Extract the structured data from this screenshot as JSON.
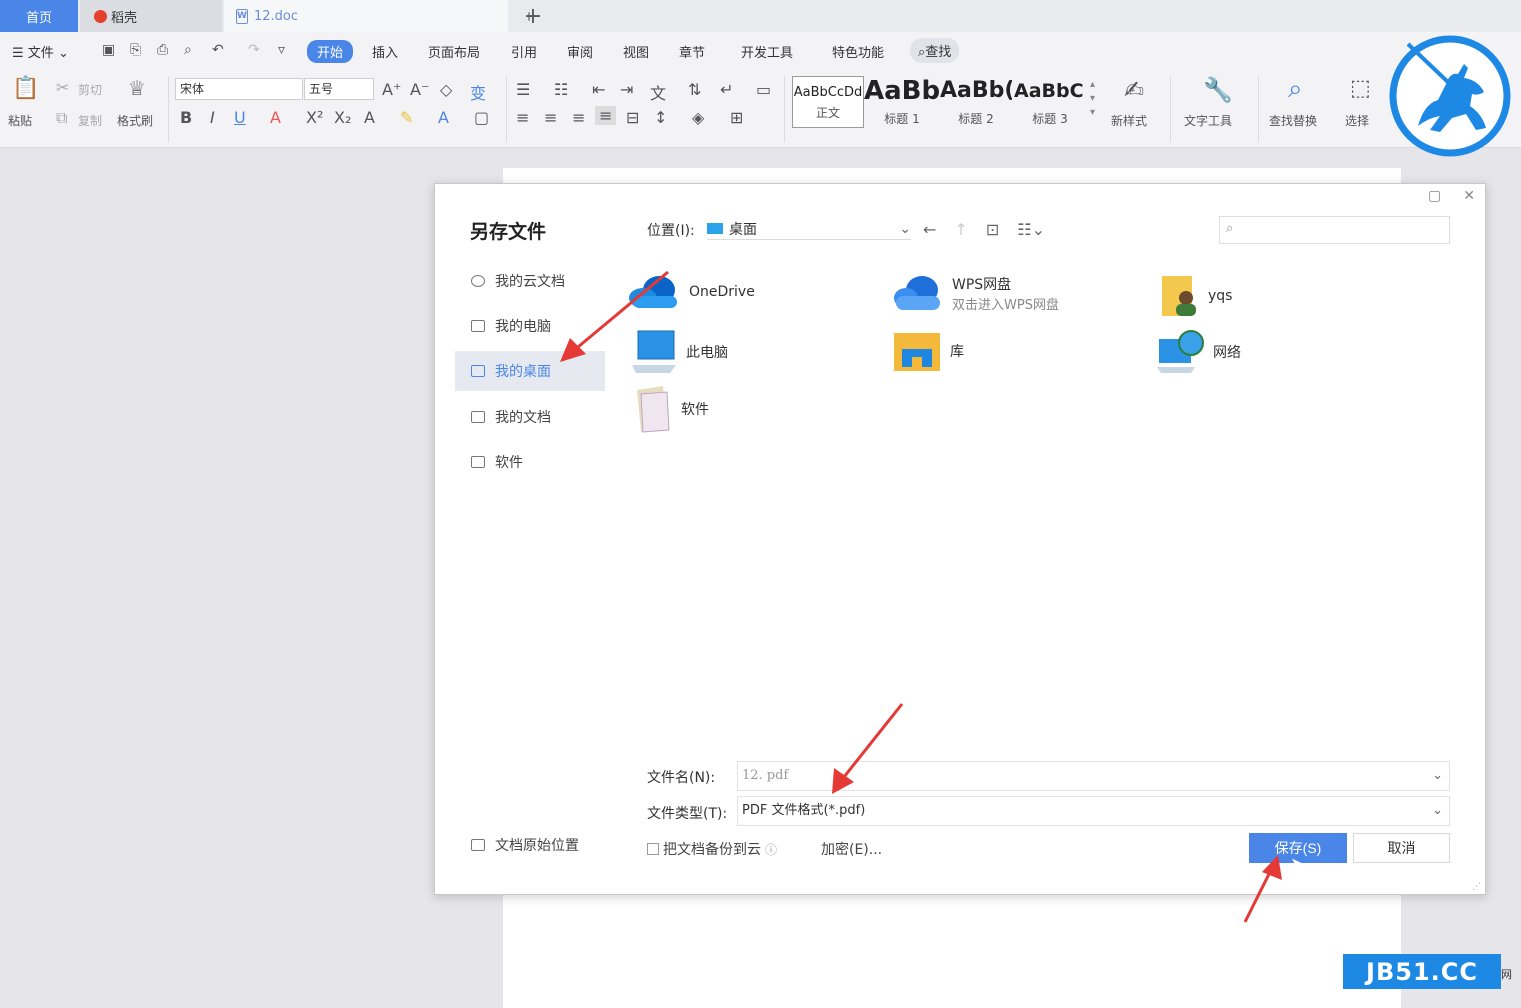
{
  "tabs": {
    "home": "首页",
    "daoke": "稻壳",
    "doc": "12.doc",
    "doc_icon_letter": "W",
    "plus": "+"
  },
  "menu": {
    "file": "文件",
    "items": [
      "开始",
      "插入",
      "页面布局",
      "引用",
      "审阅",
      "视图",
      "章节",
      "开发工具",
      "特色功能"
    ],
    "search": "查找"
  },
  "ribbon": {
    "paste": "粘贴",
    "cut": "剪切",
    "copy": "复制",
    "format_painter": "格式刷",
    "font_name": "宋体",
    "font_size": "五号",
    "styles": [
      {
        "sample": "AaBbCcDd",
        "name": "正文"
      },
      {
        "sample": "AaBb",
        "name": "标题 1"
      },
      {
        "sample": "AaBb(",
        "name": "标题 2"
      },
      {
        "sample": "AaBbC",
        "name": "标题 3"
      }
    ],
    "new_style": "新样式",
    "text_tools": "文字工具",
    "find_replace": "查找替换",
    "select": "选择"
  },
  "dialog": {
    "title": "另存文件",
    "sidebar": [
      "我的云文档",
      "我的电脑",
      "我的桌面",
      "我的文档",
      "软件"
    ],
    "active_sidebar": "我的桌面",
    "location_label": "位置(I):",
    "location_value": "桌面",
    "files": [
      {
        "name": "OneDrive",
        "sub": "",
        "icon": "onedrive-cloud-icon"
      },
      {
        "name": "WPS网盘",
        "sub": "双击进入WPS网盘",
        "icon": "wps-cloud-icon"
      },
      {
        "name": "yqs",
        "sub": "",
        "icon": "user-folder-icon"
      },
      {
        "name": "此电脑",
        "sub": "",
        "icon": "computer-icon"
      },
      {
        "name": "库",
        "sub": "",
        "icon": "library-folder-icon"
      },
      {
        "name": "网络",
        "sub": "",
        "icon": "network-icon"
      },
      {
        "name": "软件",
        "sub": "",
        "icon": "folder-icon"
      }
    ],
    "filename_label": "文件名(N):",
    "filename_value": "12. pdf",
    "filetype_label": "文件类型(T):",
    "filetype_value": "PDF 文件格式(*.pdf)",
    "backup_label": "把文档备份到云",
    "encrypt_label": "加密(E)...",
    "save_label": "保存(S)",
    "cancel_label": "取消",
    "original_location": "文档原始位置"
  },
  "watermark": {
    "text": "JB51.CC",
    "suffix": "网"
  },
  "colors": {
    "accent": "#4a86e8",
    "arrow": "#e53935",
    "watermark_bg": "#1e88e5",
    "logo": "#1e88e5"
  }
}
